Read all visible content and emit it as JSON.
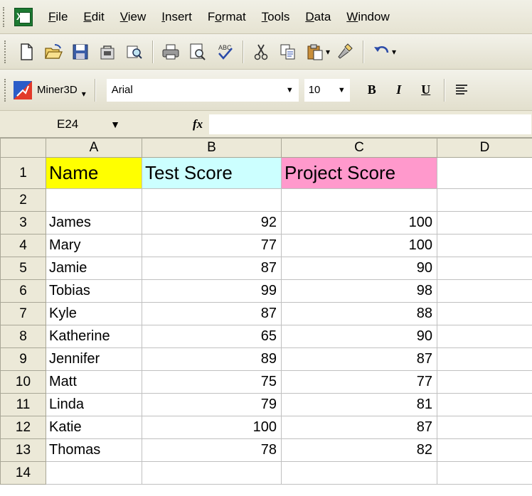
{
  "menu": {
    "app_icon": "excel-icon",
    "items": [
      {
        "label": "File",
        "accel": "F",
        "rest": "ile"
      },
      {
        "label": "Edit",
        "accel": "E",
        "rest": "dit"
      },
      {
        "label": "View",
        "accel": "V",
        "rest": "iew"
      },
      {
        "label": "Insert",
        "accel": "I",
        "rest": "nsert"
      },
      {
        "label": "Format",
        "pre": "F",
        "accel": "o",
        "rest": "rmat"
      },
      {
        "label": "Tools",
        "accel": "T",
        "rest": "ools"
      },
      {
        "label": "Data",
        "accel": "D",
        "rest": "ata"
      },
      {
        "label": "Window",
        "accel": "W",
        "rest": "indow"
      }
    ]
  },
  "standard_toolbar": {
    "icons": [
      "new-icon",
      "open-icon",
      "save-icon",
      "permission-icon",
      "research-icon",
      "print-icon",
      "print-preview-icon",
      "spelling-icon",
      "cut-icon",
      "copy-icon",
      "paste-icon",
      "format-painter-icon",
      "undo-icon"
    ]
  },
  "formatting_toolbar": {
    "addin_label": "Miner3D",
    "font_name": "Arial",
    "font_size": "10",
    "bold": "B",
    "italic": "I",
    "underline": "U"
  },
  "formula_bar": {
    "name_box": "E24",
    "fx": "fx",
    "formula": ""
  },
  "sheet": {
    "columns": [
      "A",
      "B",
      "C",
      "D"
    ],
    "header_row": {
      "row": "1",
      "name": "Name",
      "test": "Test Score",
      "project": "Project Score"
    },
    "highlight_colors": {
      "name": "#ffff00",
      "test": "#ccffff",
      "project": "#ff99cc"
    },
    "rows": [
      {
        "row": "2",
        "name": "",
        "test": "",
        "project": ""
      },
      {
        "row": "3",
        "name": "James",
        "test": "92",
        "project": "100"
      },
      {
        "row": "4",
        "name": "Mary",
        "test": "77",
        "project": "100"
      },
      {
        "row": "5",
        "name": "Jamie",
        "test": "87",
        "project": "90"
      },
      {
        "row": "6",
        "name": "Tobias",
        "test": "99",
        "project": "98"
      },
      {
        "row": "7",
        "name": "Kyle",
        "test": "87",
        "project": "88"
      },
      {
        "row": "8",
        "name": "Katherine",
        "test": "65",
        "project": "90"
      },
      {
        "row": "9",
        "name": "Jennifer",
        "test": "89",
        "project": "87"
      },
      {
        "row": "10",
        "name": "Matt",
        "test": "75",
        "project": "77"
      },
      {
        "row": "11",
        "name": "Linda",
        "test": "79",
        "project": "81"
      },
      {
        "row": "12",
        "name": "Katie",
        "test": "100",
        "project": "87"
      },
      {
        "row": "13",
        "name": "Thomas",
        "test": "78",
        "project": "82"
      },
      {
        "row": "14",
        "name": "",
        "test": "",
        "project": ""
      }
    ]
  }
}
